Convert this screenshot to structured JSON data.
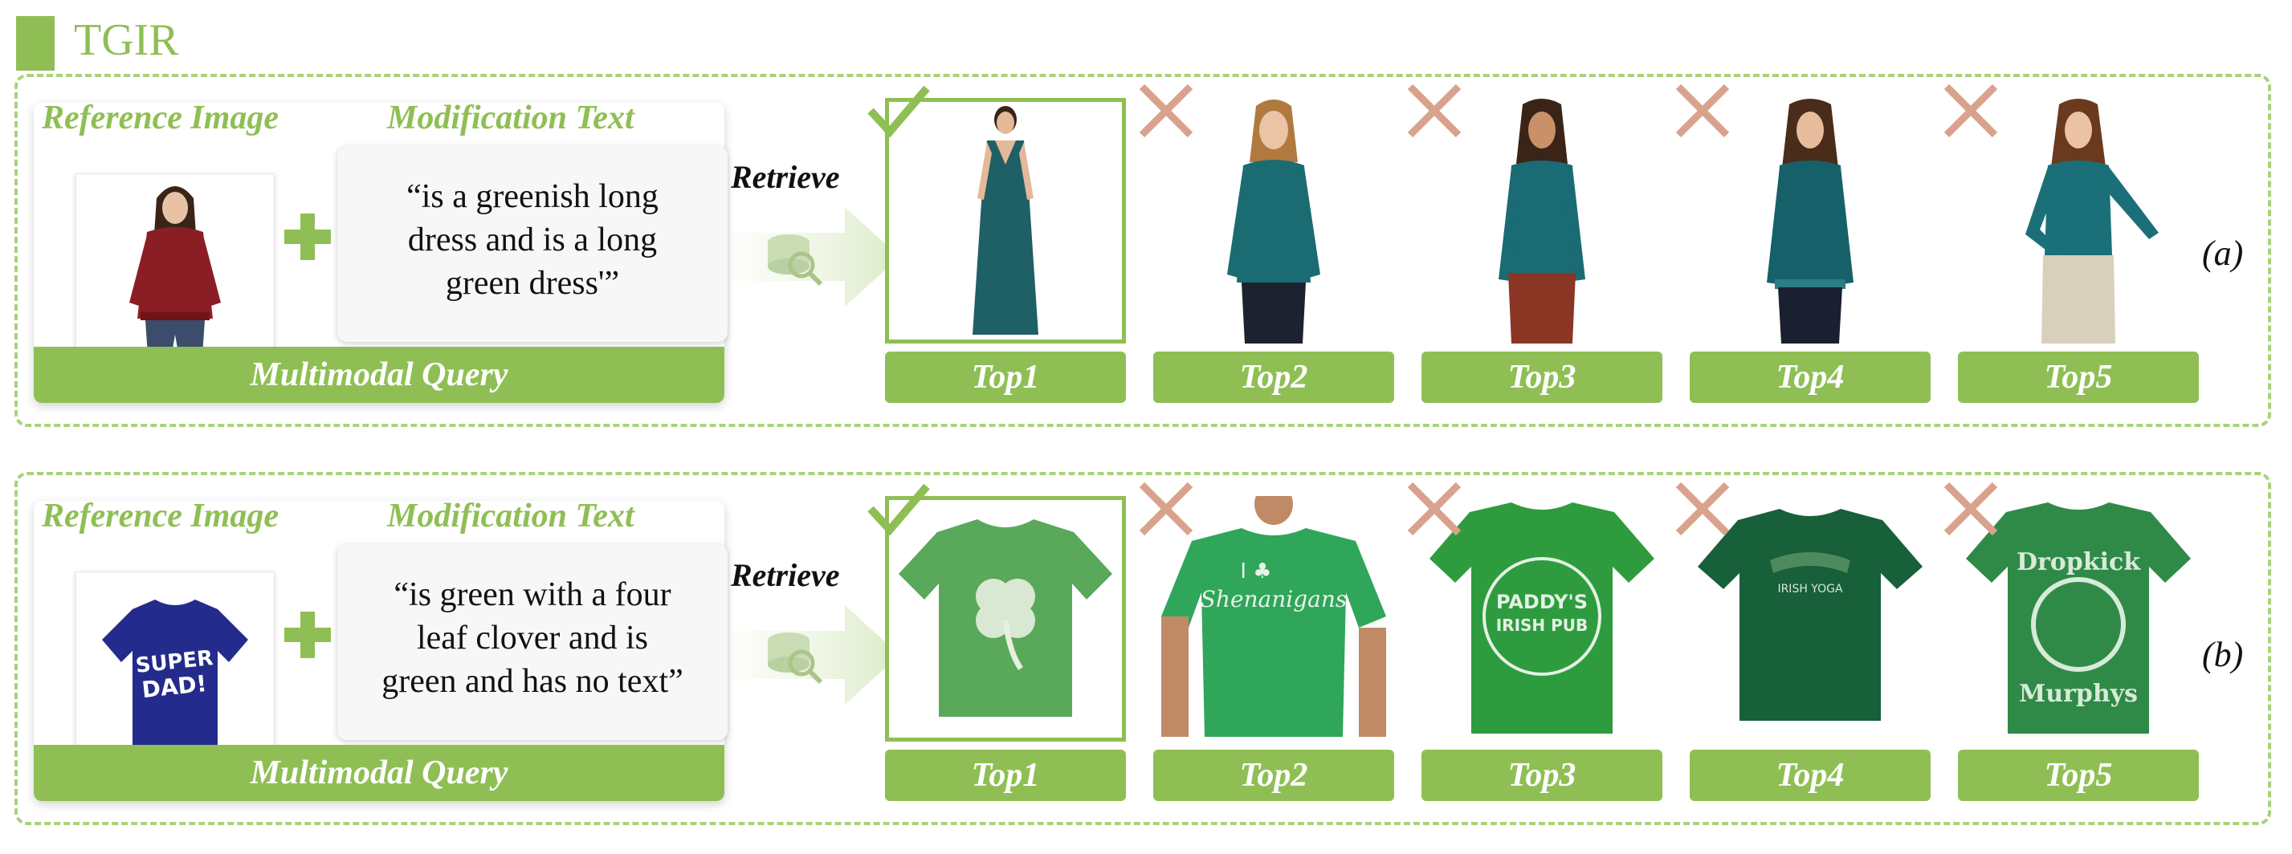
{
  "header": {
    "title": "TGIR"
  },
  "colors": {
    "accent": "#8fbf54",
    "wrong": "#d9a28c"
  },
  "panels": [
    {
      "label": "(a)",
      "query": {
        "reference_label": "Reference Image",
        "modification_label": "Modification Text",
        "modification_line1": "“is a greenish long",
        "modification_line2": "dress  and is a long",
        "modification_line3": "green dress'”",
        "footer": "Multimodal Query",
        "reference_image": "woman in dark red long-sleeve sweater"
      },
      "retrieve_label": "Retrieve",
      "results": [
        {
          "label": "Top1",
          "correct": true,
          "image": "woman in long teal maxi dress"
        },
        {
          "label": "Top2",
          "correct": false,
          "image": "woman in teal long-sleeve blouse"
        },
        {
          "label": "Top3",
          "correct": false,
          "image": "woman in teal long-sleeve top"
        },
        {
          "label": "Top4",
          "correct": false,
          "image": "woman in teal lace-trim top"
        },
        {
          "label": "Top5",
          "correct": false,
          "image": "woman in teal v-neck top and beige skirt"
        }
      ]
    },
    {
      "label": "(b)",
      "query": {
        "reference_label": "Reference Image",
        "modification_label": "Modification Text",
        "modification_line1": "“is green with a four",
        "modification_line2": "leaf clover and is",
        "modification_line3": "green and has no text”",
        "footer": "Multimodal Query",
        "reference_image": "navy t-shirt with SUPER DAD! print"
      },
      "retrieve_label": "Retrieve",
      "results": [
        {
          "label": "Top1",
          "correct": true,
          "image": "green t-shirt with four leaf clover"
        },
        {
          "label": "Top2",
          "correct": false,
          "image": "man in green Shenanigans t-shirt"
        },
        {
          "label": "Top3",
          "correct": false,
          "image": "green Paddy's Irish Pub t-shirt"
        },
        {
          "label": "Top4",
          "correct": false,
          "image": "dark green Irish Yoga t-shirt"
        },
        {
          "label": "Top5",
          "correct": false,
          "image": "green Dropkick Murphys t-shirt"
        }
      ]
    }
  ]
}
